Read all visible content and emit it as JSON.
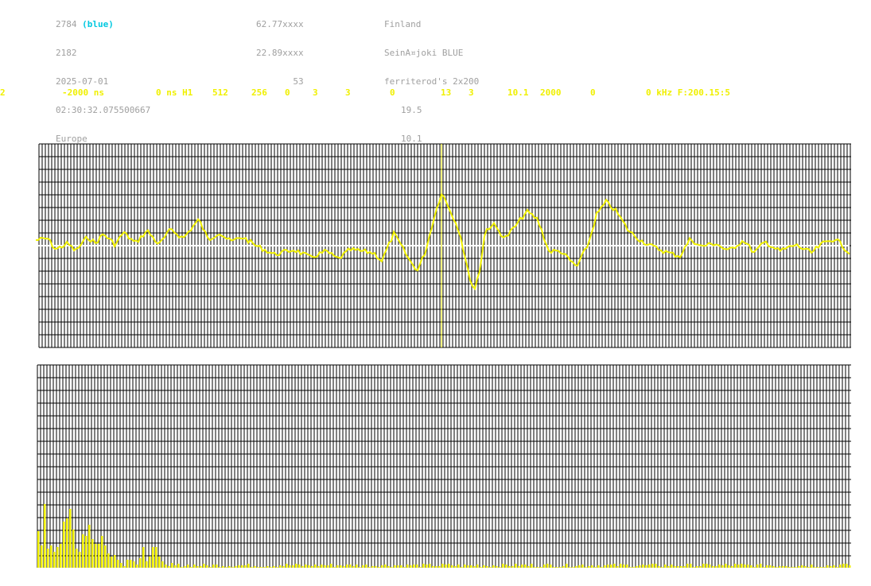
{
  "station": {
    "id": "2784",
    "id_tag": "(blue)",
    "number": "2182",
    "date": "2025-07-01",
    "time": "02:30:32.075500667",
    "region": "Europe",
    "lat": "62.77xxxx",
    "lon": "22.89xxxx",
    "value": "53",
    "country": "Finland",
    "location": "SeinA¤joki BLUE",
    "antenna": "ferriterod's 2x200",
    "val1": "19.5",
    "val2": "10.1"
  },
  "params": [
    "2",
    "-2000 ns",
    "0 ns H1",
    "512",
    "256",
    "0",
    "3",
    "3",
    "0",
    "13",
    "3",
    "10.1",
    "2000",
    "0",
    "0 kHz F:200.15:5"
  ],
  "colors": {
    "trace": "#f0f000",
    "grid": "#000000",
    "zero_line": "#ffffff",
    "blue_tag": "#00c8e0",
    "info_text": "#a0a0a0"
  }
}
